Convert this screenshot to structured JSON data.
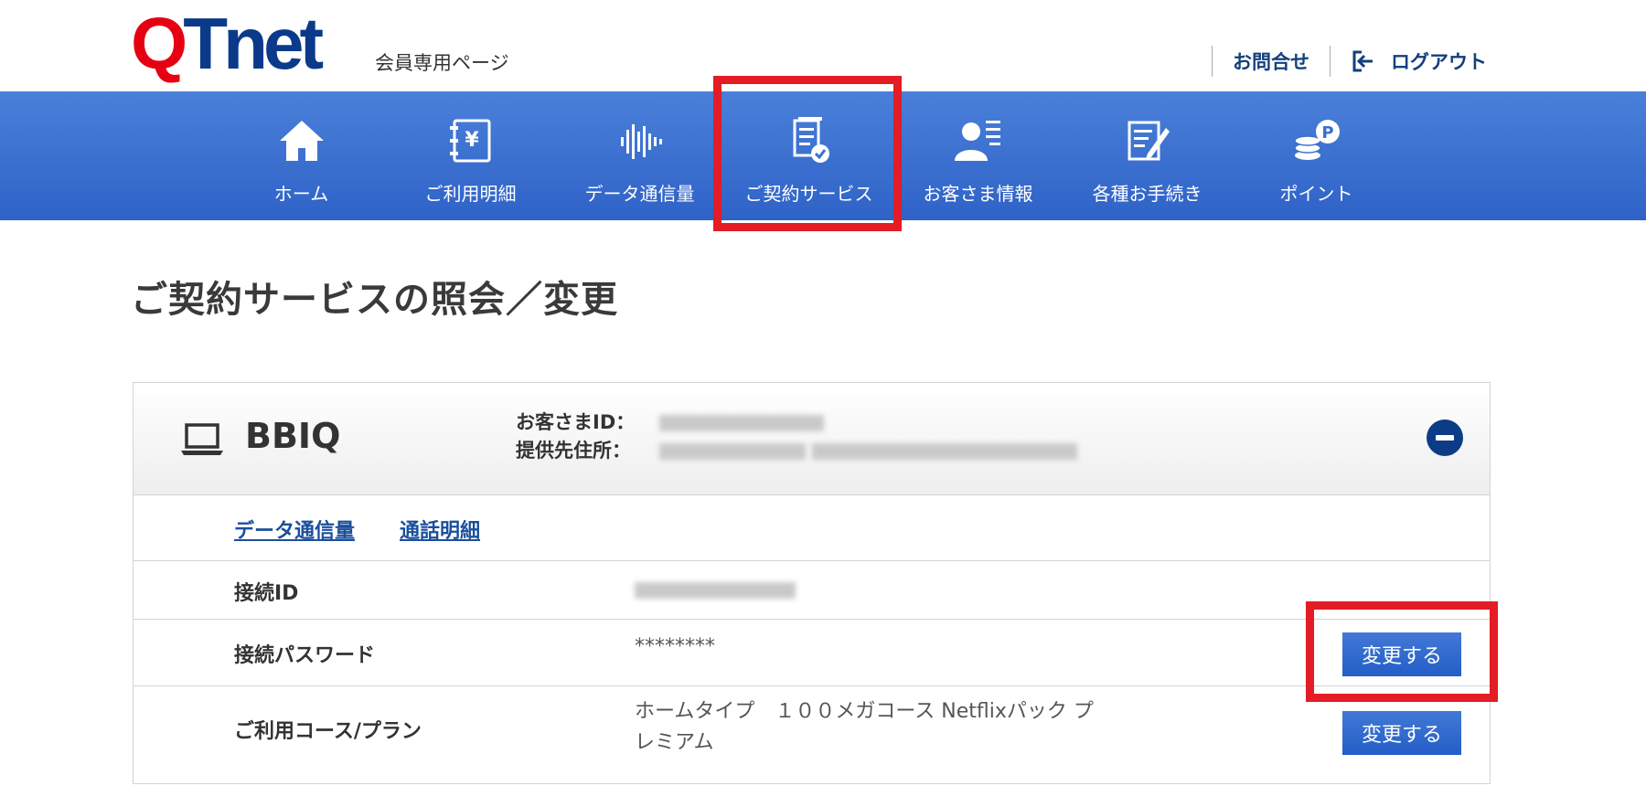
{
  "header": {
    "logo_q": "Q",
    "logo_rest": "Tnet",
    "logo_subtitle": "会員専用ページ",
    "contact_label": "お問合せ",
    "logout_label": "ログアウト"
  },
  "nav": {
    "items": [
      {
        "label": "ホーム",
        "icon": "home-icon"
      },
      {
        "label": "ご利用明細",
        "icon": "yen-notebook-icon"
      },
      {
        "label": "データ通信量",
        "icon": "soundwave-icon"
      },
      {
        "label": "ご契約サービス",
        "icon": "contract-document-icon"
      },
      {
        "label": "お客さま情報",
        "icon": "user-info-icon"
      },
      {
        "label": "各種お手続き",
        "icon": "edit-form-icon"
      },
      {
        "label": "ポイント",
        "icon": "coins-point-icon"
      }
    ],
    "active_index": 3
  },
  "page": {
    "title": "ご契約サービスの照会／変更"
  },
  "service": {
    "name": "BBIQ",
    "icon": "laptop-icon",
    "customer_id_label": "お客さまID：",
    "address_label": "提供先住所：",
    "links": [
      "データ通信量",
      "通話明細"
    ],
    "rows": [
      {
        "label": "接続ID",
        "value": "",
        "has_button": false
      },
      {
        "label": "接続パスワード",
        "value": "********",
        "has_button": true,
        "button_label": "変更する"
      },
      {
        "label": "ご利用コース/プラン",
        "value_line1": "ホームタイプ　１００メガコース Netflixパック プ",
        "value_line2": "レミアム",
        "has_button": true,
        "button_label": "変更する"
      }
    ]
  },
  "colors": {
    "nav_bg": "#3a6fd0",
    "highlight": "#e31c25",
    "logo_red": "#e60012",
    "logo_blue": "#0c3a8a",
    "link_blue": "#1a4f9c"
  }
}
